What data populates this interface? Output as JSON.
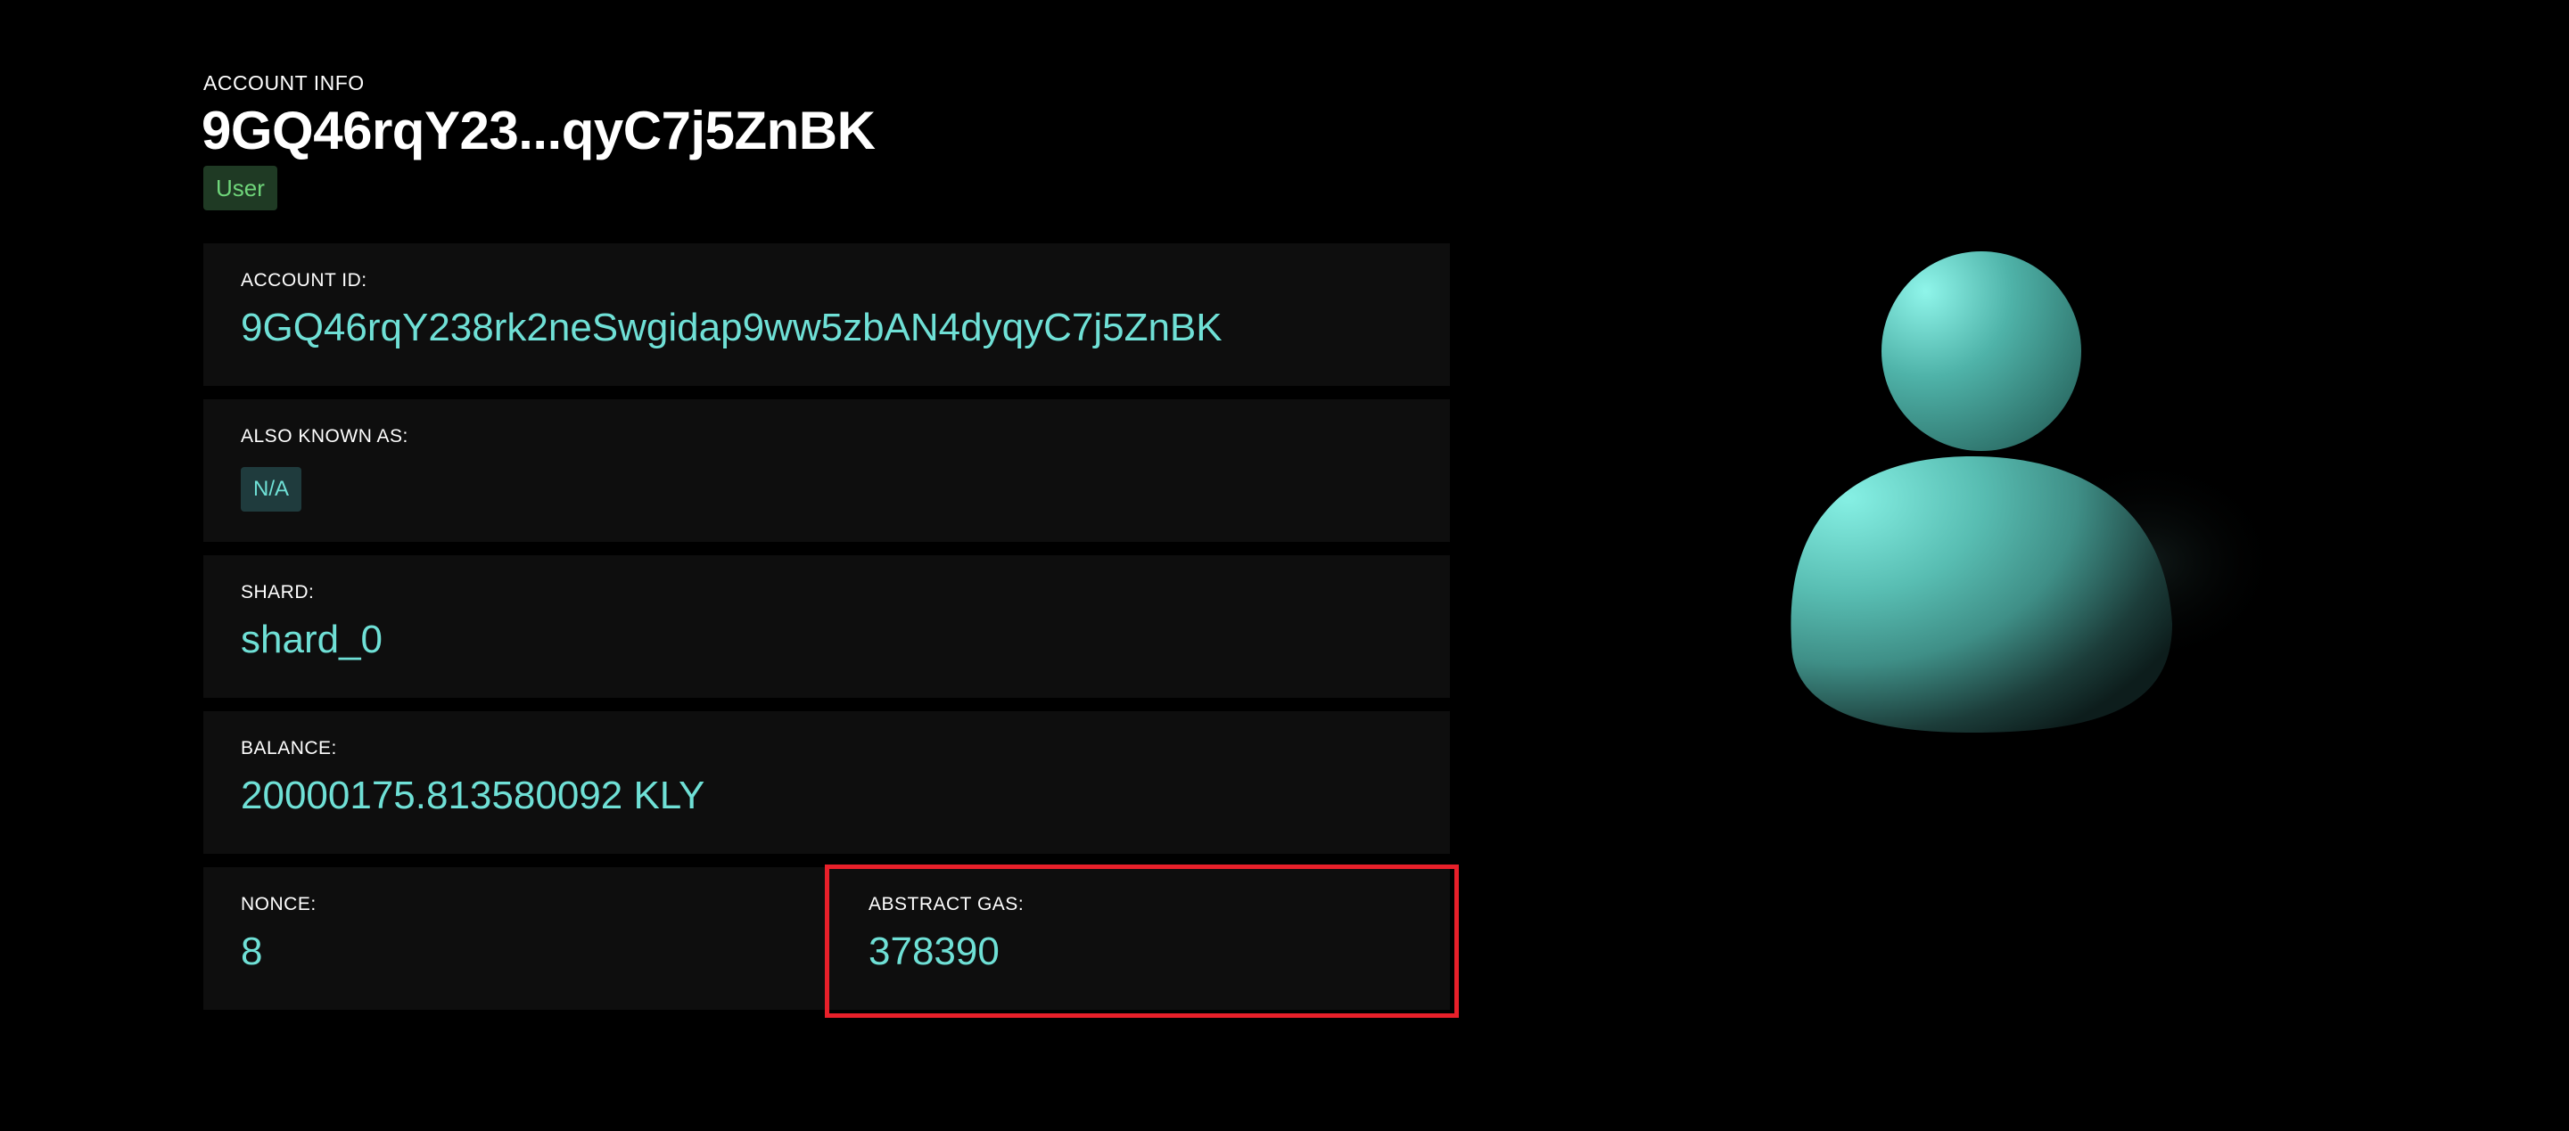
{
  "header": {
    "section_label": "ACCOUNT INFO",
    "title": "9GQ46rqY23...qyC7j5ZnBK",
    "role_badge": "User"
  },
  "account": {
    "id_label": "ACCOUNT ID:",
    "id_value": "9GQ46rqY238rk2neSwgidap9ww5zbAN4dyqyC7j5ZnBK",
    "aka_label": "ALSO KNOWN AS:",
    "aka_value": "N/A",
    "shard_label": "SHARD:",
    "shard_value": "shard_0",
    "balance_label": "BALANCE:",
    "balance_value": "20000175.813580092 KLY",
    "nonce_label": "NONCE:",
    "nonce_value": "8",
    "gas_label": "ABSTRACT GAS:",
    "gas_value": "378390"
  },
  "icons": {
    "avatar": "user-avatar-icon"
  },
  "colors": {
    "background": "#000000",
    "card_background": "#0e0e0e",
    "accent_value": "#6fe0d6",
    "user_badge_text": "#6fd57a",
    "user_badge_bg": "#1f3a24",
    "highlight_border": "#e8202a"
  }
}
